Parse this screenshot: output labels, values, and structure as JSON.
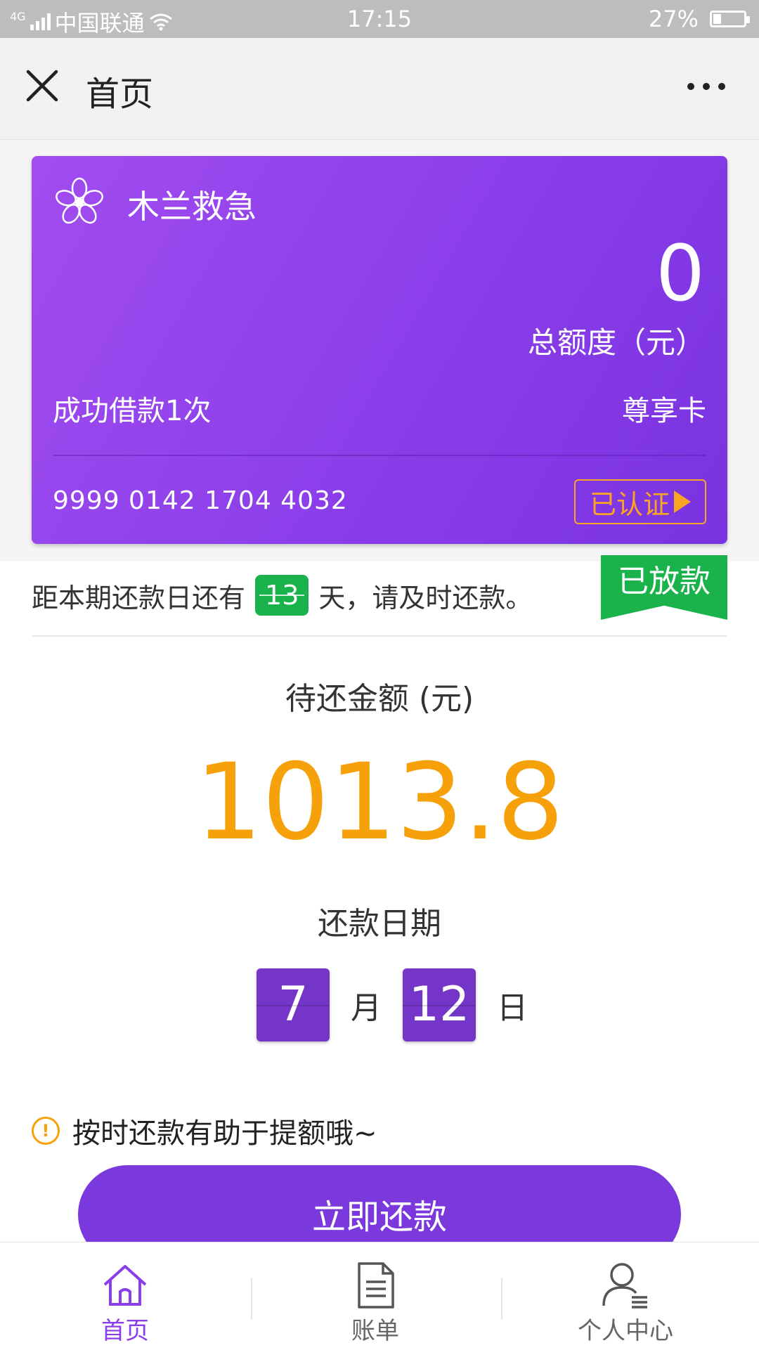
{
  "status_bar": {
    "network": "4G",
    "carrier": "中国联通",
    "time": "17:15",
    "battery": "27%",
    "battery_level": 0.27
  },
  "header": {
    "title": "首页"
  },
  "card": {
    "name": "木兰救急",
    "credit_value": "0",
    "credit_label": "总额度（元）",
    "loan_count": "成功借款1次",
    "card_type": "尊享卡",
    "card_number": "9999 0142 1704 4032",
    "verified_label": "已认证"
  },
  "due": {
    "prefix": "距本期还款日还有",
    "days": "13",
    "suffix": "天，请及时还款。",
    "status": "已放款"
  },
  "repayment": {
    "pending_label": "待还金额 (元)",
    "pending_amount": "1013.8",
    "date_label": "还款日期",
    "month": "7",
    "month_unit": "月",
    "day": "12",
    "day_unit": "日"
  },
  "tip": "按时还款有助于提额哦~",
  "repay_button": "立即还款",
  "tabs": [
    {
      "label": "首页",
      "icon": "home-icon",
      "active": true
    },
    {
      "label": "账单",
      "icon": "bill-icon",
      "active": false
    },
    {
      "label": "个人中心",
      "icon": "profile-icon",
      "active": false
    }
  ],
  "colors": {
    "brand_purple": "#8a3ee9",
    "accent_orange": "#f7a10a",
    "success_green": "#19b24b"
  }
}
